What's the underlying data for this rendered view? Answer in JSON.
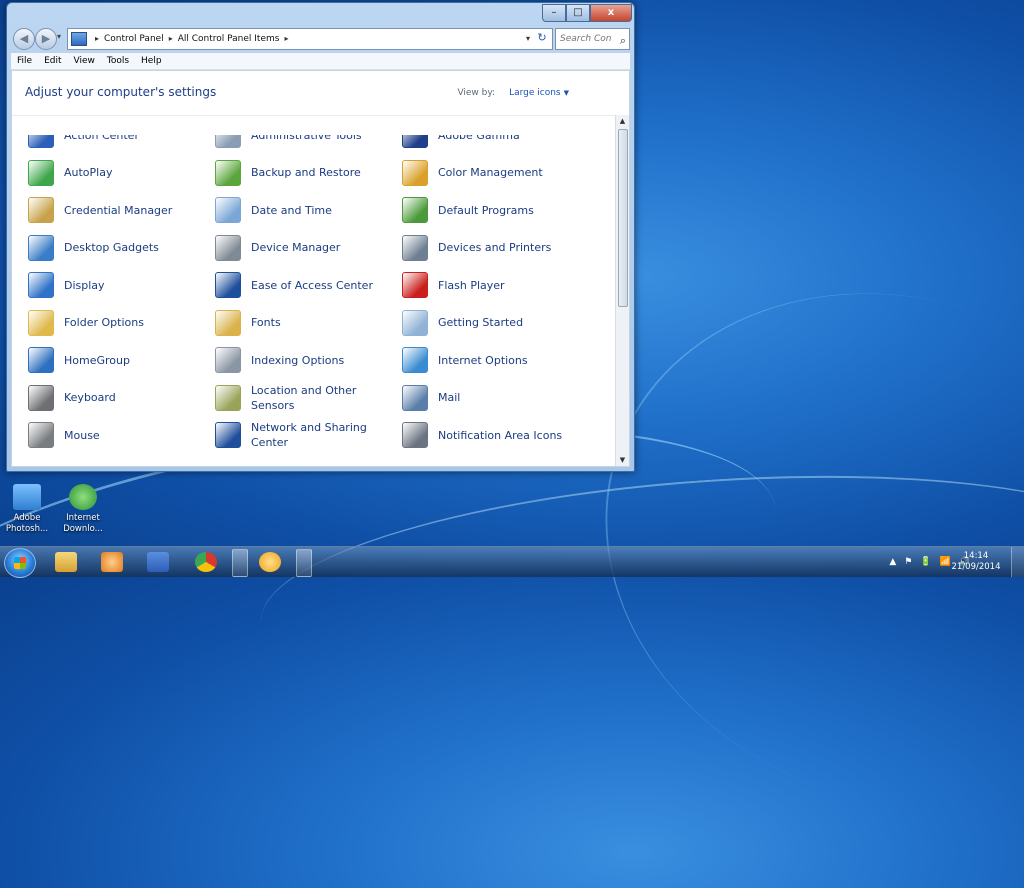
{
  "window": {
    "caption_buttons": {
      "minimize": "–",
      "maximize": "□",
      "close": "x"
    },
    "nav": {
      "back": "◀",
      "forward": "▶",
      "dropdown": "▾"
    },
    "address": {
      "crumbs": [
        "Control Panel",
        "All Control Panel Items"
      ],
      "separator": "▸",
      "dropdown": "▾",
      "refresh": "↻"
    },
    "search": {
      "placeholder": "Search Con...",
      "icon": "search-icon"
    },
    "menu": [
      "File",
      "Edit",
      "View",
      "Tools",
      "Help"
    ],
    "page_title": "Adjust your computer's settings",
    "view_by": {
      "label": "View by:",
      "value": "Large icons",
      "arrow": "▼"
    },
    "items": [
      {
        "label": "Action Center",
        "icon": "action-center-flag-icon",
        "color": "#2c5fb8"
      },
      {
        "label": "Administrative Tools",
        "icon": "administrative-tools-icon",
        "color": "#8a9db4"
      },
      {
        "label": "Adobe Gamma",
        "icon": "monitor-icon",
        "color": "#1f3f8a"
      },
      {
        "label": "AutoPlay",
        "icon": "autoplay-icon",
        "color": "#3ea64a"
      },
      {
        "label": "Backup and Restore",
        "icon": "backup-restore-icon",
        "color": "#5aa53c"
      },
      {
        "label": "Color Management",
        "icon": "color-management-icon",
        "color": "#d9a12b"
      },
      {
        "label": "Credential Manager",
        "icon": "credential-vault-icon",
        "color": "#c8a24a"
      },
      {
        "label": "Date and Time",
        "icon": "calendar-clock-icon",
        "color": "#7ba6d6"
      },
      {
        "label": "Default Programs",
        "icon": "default-programs-icon",
        "color": "#4b9a3a"
      },
      {
        "label": "Desktop Gadgets",
        "icon": "desktop-gadgets-icon",
        "color": "#3a7cc6"
      },
      {
        "label": "Device Manager",
        "icon": "device-manager-icon",
        "color": "#7f8a95"
      },
      {
        "label": "Devices and Printers",
        "icon": "printer-icon",
        "color": "#6e7f92"
      },
      {
        "label": "Display",
        "icon": "display-icon",
        "color": "#2f72c8"
      },
      {
        "label": "Ease of Access Center",
        "icon": "ease-of-access-icon",
        "color": "#1d4f9c"
      },
      {
        "label": "Flash Player",
        "icon": "flash-player-icon",
        "color": "#c9201d"
      },
      {
        "label": "Folder Options",
        "icon": "folder-options-icon",
        "color": "#e0b94a"
      },
      {
        "label": "Fonts",
        "icon": "fonts-folder-icon",
        "color": "#d9b24a"
      },
      {
        "label": "Getting Started",
        "icon": "getting-started-icon",
        "color": "#8fb2d6"
      },
      {
        "label": "HomeGroup",
        "icon": "homegroup-icon",
        "color": "#2d6fc0"
      },
      {
        "label": "Indexing Options",
        "icon": "indexing-options-icon",
        "color": "#8a96a3"
      },
      {
        "label": "Internet Options",
        "icon": "internet-options-icon",
        "color": "#3a8bd0"
      },
      {
        "label": "Keyboard",
        "icon": "keyboard-icon",
        "color": "#6d6f72"
      },
      {
        "label": "Location and Other Sensors",
        "icon": "location-sensors-icon",
        "color": "#9aa35a"
      },
      {
        "label": "Mail",
        "icon": "mail-icon",
        "color": "#5a7ea8"
      },
      {
        "label": "Mouse",
        "icon": "mouse-icon",
        "color": "#7a7d80"
      },
      {
        "label": "Network and Sharing Center",
        "icon": "network-sharing-icon",
        "color": "#1f4f9a"
      },
      {
        "label": "Notification Area Icons",
        "icon": "notification-area-icon",
        "color": "#6b7480"
      }
    ],
    "scrollbar": {
      "up": "▲",
      "down": "▼"
    }
  },
  "desktop_icons": [
    {
      "label": "Adobe Photosh...",
      "icon": "adobe-photoshop-icon",
      "color": "#2f7fd0"
    },
    {
      "label": "Internet Downlo...",
      "icon": "internet-download-manager-icon",
      "color": "#3ba84a"
    }
  ],
  "taskbar": {
    "apps": [
      {
        "name": "windows-explorer-icon",
        "color": "#e2b84a"
      },
      {
        "name": "media-player-icon",
        "color": "#e07a1e"
      },
      {
        "name": "word-icon",
        "color": "#2b5eb5"
      },
      {
        "name": "chrome-icon",
        "color": "#d9382c"
      },
      {
        "name": "avast-icon",
        "color": "#f0a21c"
      }
    ],
    "tray_icons": [
      "▲",
      "⚑",
      "🔋",
      "📶",
      "🔊"
    ],
    "clock": {
      "time": "14:14",
      "date": "21/09/2014"
    }
  }
}
